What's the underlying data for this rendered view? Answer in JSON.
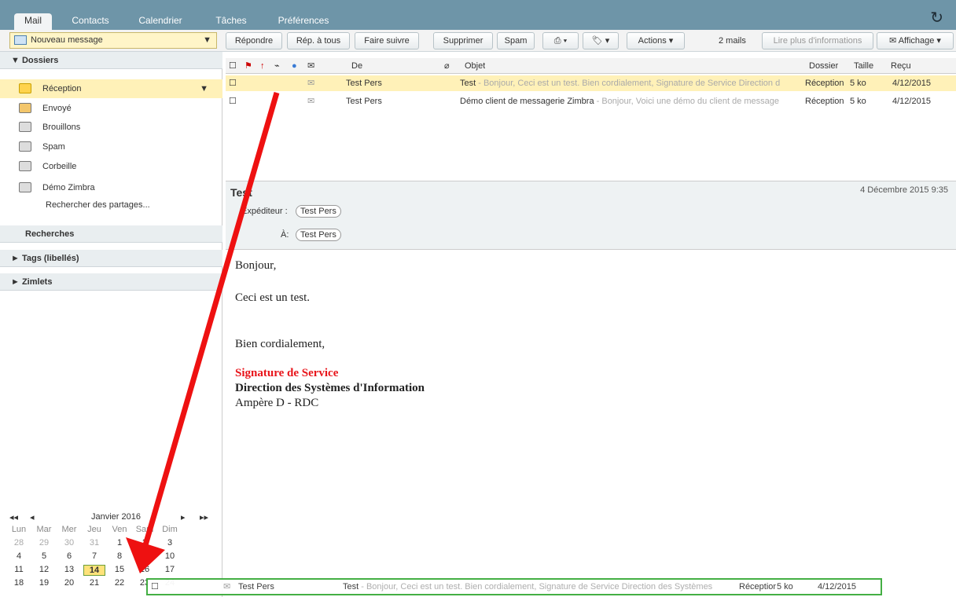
{
  "tabs": [
    "Mail",
    "Contacts",
    "Calendrier",
    "Tâches",
    "Préférences"
  ],
  "toolbar": {
    "new_message": "Nouveau message",
    "reply": "Répondre",
    "reply_all": "Rép. à tous",
    "forward": "Faire suivre",
    "delete": "Supprimer",
    "spam": "Spam",
    "actions": "Actions",
    "count": "2 mails",
    "read_more": "Lire plus d'informations",
    "view": "Affichage"
  },
  "sidebar": {
    "folders_title": "Dossiers",
    "folders": [
      "Réception",
      "Envoyé",
      "Brouillons",
      "Spam",
      "Corbeille",
      "Démo Zimbra"
    ],
    "search_shares": "Rechercher des partages...",
    "searches": "Recherches",
    "tags": "Tags (libellés)",
    "zimlets": "Zimlets"
  },
  "list": {
    "headers": {
      "from": "De",
      "subject": "Objet",
      "folder": "Dossier",
      "size": "Taille",
      "received": "Reçu"
    },
    "rows": [
      {
        "from": "Test Pers",
        "subject": "Test",
        "fragment": " - Bonjour, Ceci est un test. Bien cordialement, Signature de Service Direction d",
        "folder": "Réception",
        "size": "5 ko",
        "date": "4/12/2015"
      },
      {
        "from": "Test Pers",
        "subject": "Démo client de messagerie Zimbra",
        "fragment": " - Bonjour, Voici une démo du client de message",
        "folder": "Réception",
        "size": "5 ko",
        "date": "4/12/2015"
      }
    ]
  },
  "preview": {
    "subject": "Test",
    "date": "4 Décembre 2015 9:35",
    "from_label": "Expéditeur :",
    "from": "Test Pers",
    "to_label": "À:",
    "to": "Test Pers",
    "greeting": "Bonjour,",
    "line1": "Ceci est un test.",
    "closing": "Bien cordialement,",
    "sig1": "Signature de Service",
    "sig2": "Direction des Systèmes d'Information",
    "sig3": "Ampère D - RDC"
  },
  "calendar": {
    "month": "Janvier 2016",
    "days": [
      "Lun",
      "Mar",
      "Mer",
      "Jeu",
      "Ven",
      "Sam",
      "Dim"
    ],
    "weeks": [
      [
        "28",
        "29",
        "30",
        "31",
        "1",
        "2",
        "3"
      ],
      [
        "4",
        "5",
        "6",
        "7",
        "8",
        "9",
        "10"
      ],
      [
        "11",
        "12",
        "13",
        "14",
        "15",
        "16",
        "17"
      ],
      [
        "18",
        "19",
        "20",
        "21",
        "22",
        "23",
        "24"
      ]
    ]
  },
  "drag": {
    "from": "Test Pers",
    "subject": "Test",
    "fragment": " - Bonjour, Ceci est un test. Bien cordialement, Signature de Service Direction des Systèmes",
    "folder": "Réceptior",
    "size": "5 ko",
    "date": "4/12/2015"
  },
  "colors": {
    "accent": "#6e95a8",
    "selected": "#fff1b8",
    "sig": "#e8141a",
    "arrow": "#ee1111"
  }
}
